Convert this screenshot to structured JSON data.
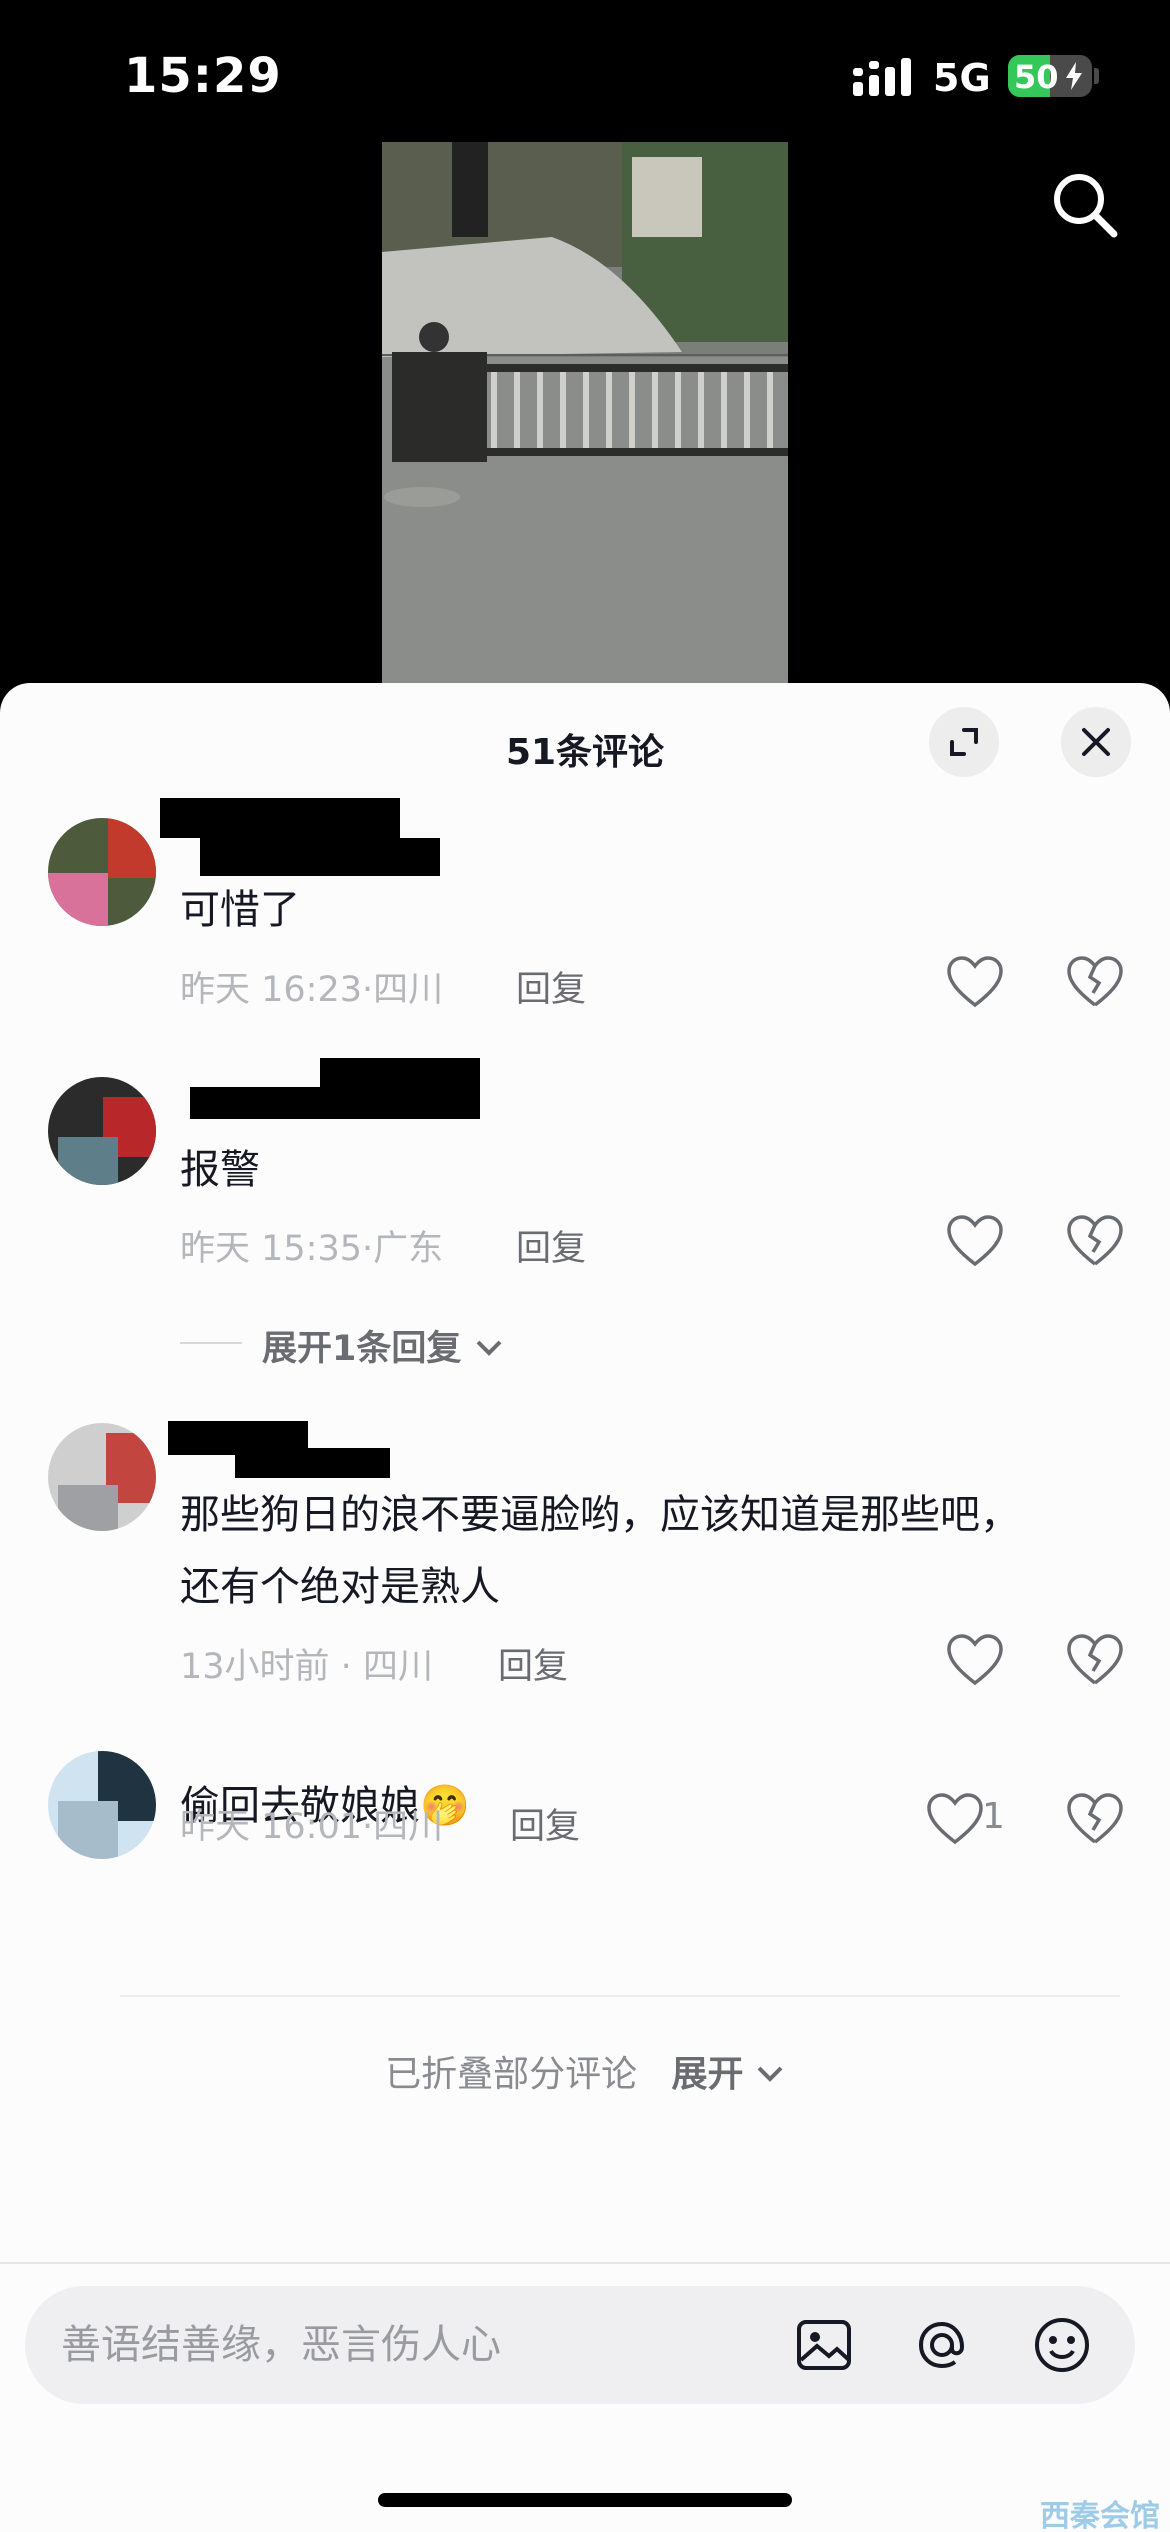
{
  "status_bar": {
    "time": "15:29",
    "network": "5G",
    "battery": "50",
    "battery_level": 0.5
  },
  "icons": {
    "search": "search-icon",
    "expand": "fullscreen-icon",
    "close": "close-icon"
  },
  "sheet": {
    "title": "51条评论",
    "comments": [
      {
        "text": "可惜了",
        "time": "昨天 16:23",
        "location": "四川",
        "reply": "回复"
      },
      {
        "text": "报警",
        "time": "昨天 15:35",
        "location": "广东",
        "reply": "回复",
        "expand_replies": "展开1条回复"
      },
      {
        "text_line1": "那些狗日的浪不要逼脸哟，应该知道是那些吧，",
        "text_line2": "还有个绝对是熟人",
        "time": "13小时前",
        "location": "四川",
        "reply": "回复"
      },
      {
        "text": "偷回去敬娘娘🤭",
        "time": "昨天 16:01",
        "location": "四川",
        "reply": "回复",
        "likes": "1"
      }
    ],
    "folded_text": "已折叠部分评论",
    "folded_expand": "展开"
  },
  "input": {
    "placeholder": "善语结善缘，恶言伤人心"
  },
  "watermark": "西秦会馆",
  "colors": {
    "accent_green": "#35c759",
    "text_primary": "#161823",
    "text_secondary": "#b5b6bb"
  }
}
